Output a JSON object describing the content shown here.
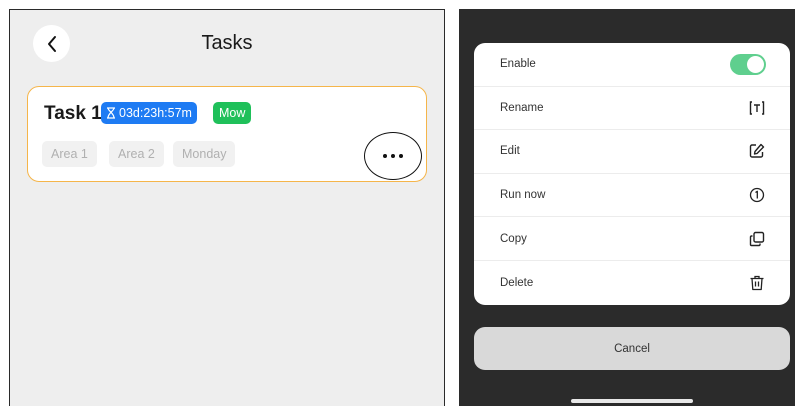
{
  "left": {
    "title": "Tasks",
    "task": {
      "name": "Task 1",
      "countdown": "03d:23h:57m",
      "type": "Mow",
      "chips": [
        "Area 1",
        "Area 2",
        "Monday"
      ]
    }
  },
  "sheet": {
    "rows": [
      {
        "label": "Enable",
        "icon": "toggle-on"
      },
      {
        "label": "Rename",
        "icon": "rename-text-icon"
      },
      {
        "label": "Edit",
        "icon": "edit-pencil-icon"
      },
      {
        "label": "Run now",
        "icon": "run-once-icon"
      },
      {
        "label": "Copy",
        "icon": "copy-icon"
      },
      {
        "label": "Delete",
        "icon": "trash-icon"
      }
    ],
    "cancel": "Cancel"
  },
  "colors": {
    "card_border": "#f5b54a",
    "timer_badge": "#1e7bf3",
    "type_badge": "#1fc05a",
    "toggle_on": "#5fcf8e"
  }
}
